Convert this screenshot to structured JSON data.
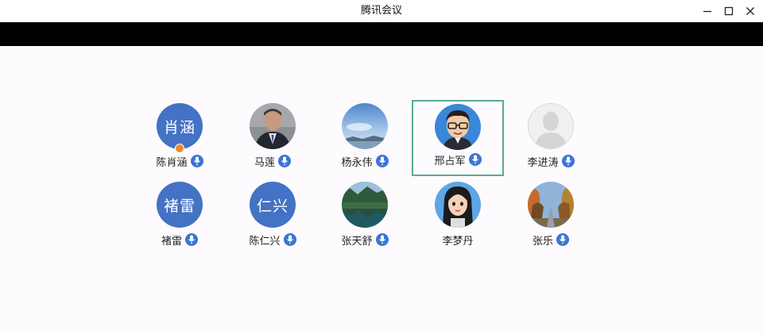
{
  "window": {
    "title": "腾讯会议",
    "controls": {
      "minimize": "minimize",
      "maximize": "maximize",
      "close": "close"
    }
  },
  "participants": [
    {
      "name": "陈肖涵",
      "avatar_type": "text",
      "avatar_text": "肖涵",
      "host": true,
      "mic": "mic-icon"
    },
    {
      "name": "马莲",
      "avatar_type": "photo",
      "photo": "man-portrait",
      "host": false,
      "mic": "mic-icon"
    },
    {
      "name": "杨永伟",
      "avatar_type": "photo",
      "photo": "sky-landscape",
      "host": false,
      "mic": "mic-icon"
    },
    {
      "name": "邢占军",
      "avatar_type": "photo",
      "photo": "cartoon-man-glasses",
      "host": false,
      "mic": "mic-icon",
      "selected": true
    },
    {
      "name": "李进涛",
      "avatar_type": "photo",
      "photo": "default-silhouette",
      "host": false,
      "mic": "mic-icon"
    },
    {
      "name": "褚雷",
      "avatar_type": "text",
      "avatar_text": "褚雷",
      "host": false,
      "mic": "mic-icon"
    },
    {
      "name": "陈仁兴",
      "avatar_type": "text",
      "avatar_text": "仁兴",
      "host": false,
      "mic": "mic-icon"
    },
    {
      "name": "张天舒",
      "avatar_type": "photo",
      "photo": "lake-landscape",
      "host": false,
      "mic": "mic-icon"
    },
    {
      "name": "李梦丹",
      "avatar_type": "photo",
      "photo": "cartoon-woman",
      "host": false,
      "mic": ""
    },
    {
      "name": "张乐",
      "avatar_type": "photo",
      "photo": "autumn-road",
      "host": false,
      "mic": "mic-icon"
    }
  ],
  "colors": {
    "accent_blue": "#4472c4",
    "mic_blue": "#3a75d6",
    "selected_border": "#5aaa95",
    "host_badge": "#ee8a2e",
    "black_bar": "#000000"
  }
}
